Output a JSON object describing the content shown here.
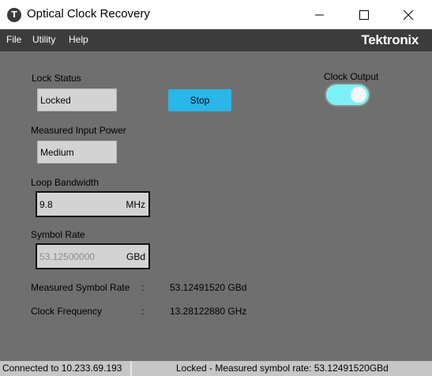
{
  "window": {
    "title": "Optical Clock Recovery",
    "icon": "tektronix-app-icon",
    "icon_glyph": "Τ",
    "minimize_glyph": "min",
    "maximize_glyph": "max",
    "close_glyph": "close"
  },
  "menu": {
    "items": [
      "File",
      "Utility",
      "Help"
    ],
    "logo": "Tektronix"
  },
  "lock_status": {
    "label": "Lock Status",
    "value": "Locked"
  },
  "stop_button": {
    "label": "Stop"
  },
  "clock_output": {
    "label": "Clock Output",
    "on": true
  },
  "measured_input_power": {
    "label": "Measured Input Power",
    "value": "Medium"
  },
  "loop_bandwidth": {
    "label": "Loop Bandwidth",
    "value": "9.8",
    "unit": "MHz"
  },
  "symbol_rate": {
    "label": "Symbol Rate",
    "value": "53.12500000",
    "unit": "GBd"
  },
  "measured_symbol_rate": {
    "label": "Measured Symbol Rate",
    "sep": ":",
    "value": "53.12491520 GBd"
  },
  "clock_frequency": {
    "label": "Clock Frequency",
    "sep": ":",
    "value": "13.28122880 GHz"
  },
  "status": {
    "connection": "Connected to 10.233.69.193",
    "message": "Locked - Measured symbol rate: 53.12491520GBd"
  },
  "colors": {
    "panel_bg": "#6f6f6f",
    "menubar_bg": "#3c3c3c",
    "accent_button": "#29b6e8",
    "toggle_on": "#7cf1f5",
    "statusbar_bg": "#c6c6c6"
  }
}
